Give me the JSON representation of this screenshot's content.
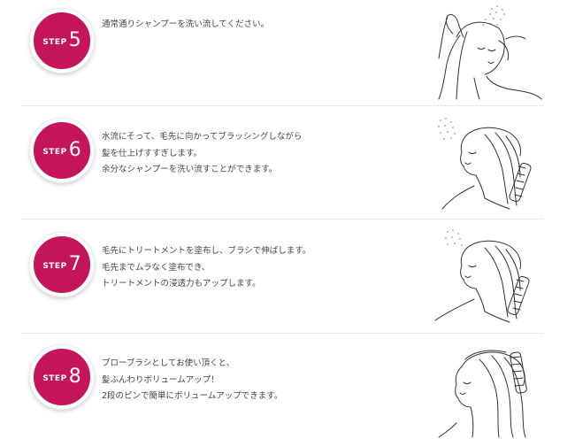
{
  "steps": [
    {
      "word": "STEP",
      "number": "5",
      "lines": [
        "通常通りシャンプーを洗い流してください。"
      ],
      "illustration": "woman-rinsing-hair-under-shower-illustration"
    },
    {
      "word": "STEP",
      "number": "6",
      "lines": [
        "水流にそって、毛先に向かってブラッシングしながら",
        "髪を仕上げすすぎします。",
        "余分なシャンプーを洗い流すことができます。"
      ],
      "illustration": "woman-brushing-hair-under-shower-illustration"
    },
    {
      "word": "STEP",
      "number": "7",
      "lines": [
        "毛先にトリートメントを塗布し、ブラシで伸ばします。",
        "毛先までムラなく塗布でき、",
        "トリートメントの浸透力もアップします。"
      ],
      "illustration": "woman-applying-treatment-with-brush-illustration"
    },
    {
      "word": "STEP",
      "number": "8",
      "lines": [
        "ブローブラシとしてお使い頂くと、",
        "髪ふんわりボリュームアップ！",
        "2段のピンで簡単にボリュームアップできます。"
      ],
      "illustration": "woman-blow-drying-with-brush-illustration"
    }
  ],
  "colors": {
    "badge": "#c4155a",
    "text": "#444444",
    "divider": "#d8d8d8"
  }
}
